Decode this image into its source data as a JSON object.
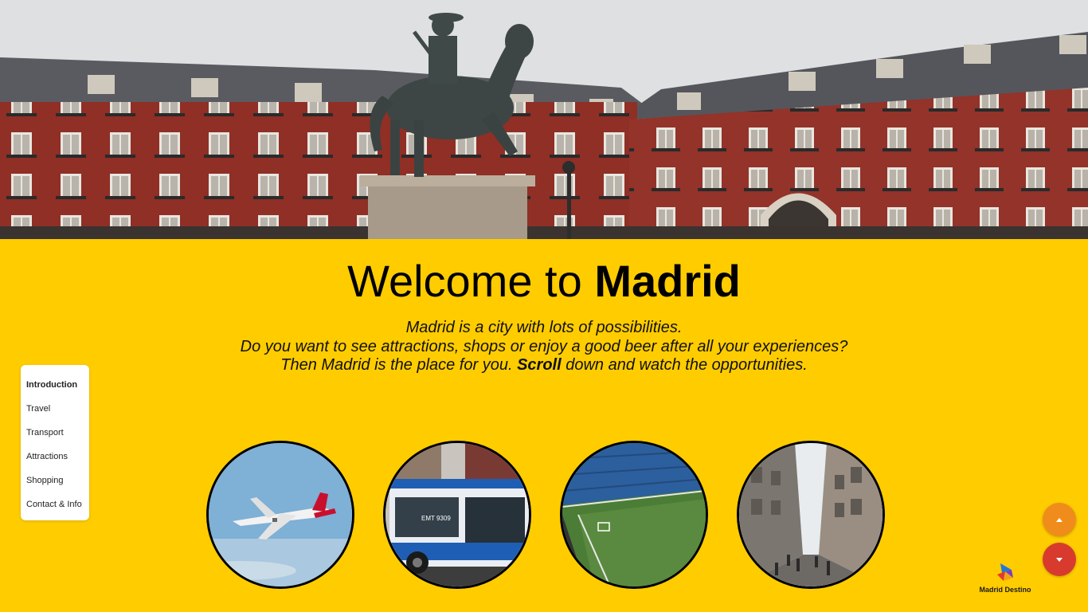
{
  "hero": {
    "image_description_icon": "plaza-mayor-photo"
  },
  "welcome": {
    "prefix": "Welcome to ",
    "city": "Madrid"
  },
  "intro": {
    "line1": "Madrid is a city with lots of possibilities.",
    "line2": "Do you want to see attractions, shops or enjoy a good beer after all your experiences?",
    "line3_before": "Then Madrid is the place for you. ",
    "line3_bold": "Scroll",
    "line3_after": " down and watch the opportunities."
  },
  "sidenav": {
    "items": [
      {
        "label": "Introduction",
        "active": true
      },
      {
        "label": "Travel"
      },
      {
        "label": "Transport"
      },
      {
        "label": "Attractions"
      },
      {
        "label": "Shopping"
      },
      {
        "label": "Contact & Info"
      }
    ]
  },
  "circles": [
    {
      "icon": "airplane-photo"
    },
    {
      "icon": "bus-photo"
    },
    {
      "icon": "stadium-photo"
    },
    {
      "icon": "shopping-street-photo"
    }
  ],
  "scroll_buttons": {
    "up_icon": "caret-up-icon",
    "down_icon": "caret-down-icon"
  },
  "logo": {
    "text": "Madrid Destino"
  },
  "colors": {
    "background": "#ffcc00",
    "up_button": "#f08c1c",
    "down_button": "#d93a2e"
  }
}
